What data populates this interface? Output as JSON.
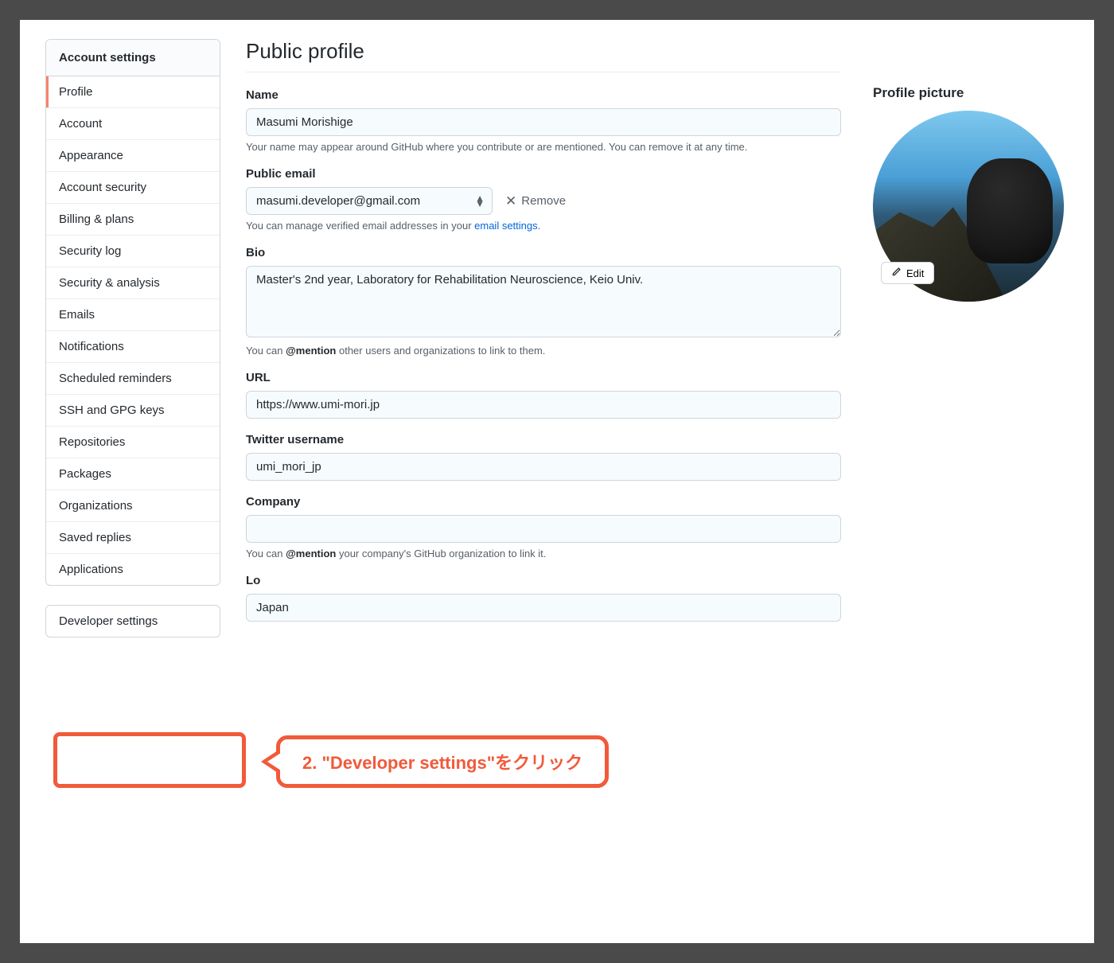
{
  "sidebar": {
    "header": "Account settings",
    "items": [
      {
        "label": "Profile",
        "selected": true
      },
      {
        "label": "Account"
      },
      {
        "label": "Appearance"
      },
      {
        "label": "Account security"
      },
      {
        "label": "Billing & plans"
      },
      {
        "label": "Security log"
      },
      {
        "label": "Security & analysis"
      },
      {
        "label": "Emails"
      },
      {
        "label": "Notifications"
      },
      {
        "label": "Scheduled reminders"
      },
      {
        "label": "SSH and GPG keys"
      },
      {
        "label": "Repositories"
      },
      {
        "label": "Packages"
      },
      {
        "label": "Organizations"
      },
      {
        "label": "Saved replies"
      },
      {
        "label": "Applications"
      }
    ],
    "secondary": {
      "label": "Developer settings"
    }
  },
  "page": {
    "title": "Public profile"
  },
  "form": {
    "name": {
      "label": "Name",
      "value": "Masumi Morishige",
      "note": "Your name may appear around GitHub where you contribute or are mentioned. You can remove it at any time."
    },
    "email": {
      "label": "Public email",
      "value": "masumi.developer@gmail.com",
      "remove_label": "Remove",
      "note_prefix": "You can manage verified email addresses in your ",
      "note_link": "email settings",
      "note_suffix": "."
    },
    "bio": {
      "label": "Bio",
      "value": "Master's 2nd year, Laboratory for Rehabilitation Neuroscience, Keio Univ.",
      "note_prefix": "You can ",
      "note_bold": "@mention",
      "note_suffix": " other users and organizations to link to them."
    },
    "url": {
      "label": "URL",
      "value": "https://www.umi-mori.jp"
    },
    "twitter": {
      "label": "Twitter username",
      "value": "umi_mori_jp"
    },
    "company": {
      "label": "Company",
      "value": "",
      "note_prefix": "You can ",
      "note_bold": "@mention",
      "note_suffix": " your company's GitHub organization to link it."
    },
    "location": {
      "label_partial": "Lo",
      "value": "Japan"
    }
  },
  "picture": {
    "heading": "Profile picture",
    "edit_label": "Edit"
  },
  "annotation": {
    "callout_text": "2. \"Developer settings\"をクリック"
  }
}
